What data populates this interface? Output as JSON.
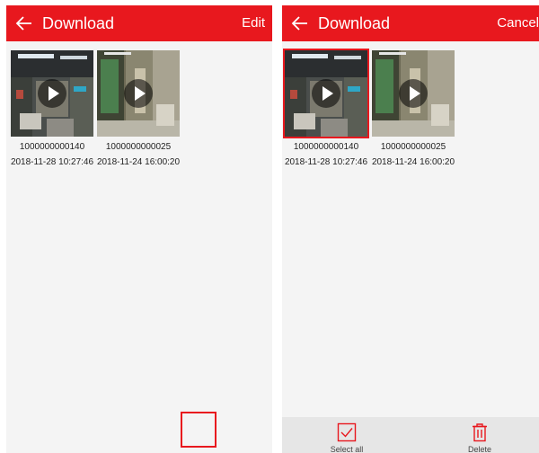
{
  "left": {
    "header": {
      "title": "Download",
      "action_label": "Edit"
    },
    "items": [
      {
        "name": "1000000000140",
        "date": "2018-11-28 10:27:46"
      },
      {
        "name": "1000000000025",
        "date": "2018-11-24 16:00:20"
      }
    ]
  },
  "right": {
    "header": {
      "title": "Download",
      "action_label": "Cancel"
    },
    "items": [
      {
        "name": "1000000000140",
        "date": "2018-11-28 10:27:46",
        "selected": true
      },
      {
        "name": "1000000000025",
        "date": "2018-11-24 16:00:20",
        "selected": false
      }
    ],
    "bottom_bar": {
      "select_all_label": "Select all",
      "delete_label": "Delete"
    }
  },
  "colors": {
    "accent": "#e8181e",
    "bottom_bar": "#e6e6e6",
    "background": "#f4f4f4"
  },
  "icons": {
    "back": "arrow-left-icon",
    "play": "play-icon",
    "select_all": "checkbox-icon",
    "delete": "trash-icon"
  }
}
